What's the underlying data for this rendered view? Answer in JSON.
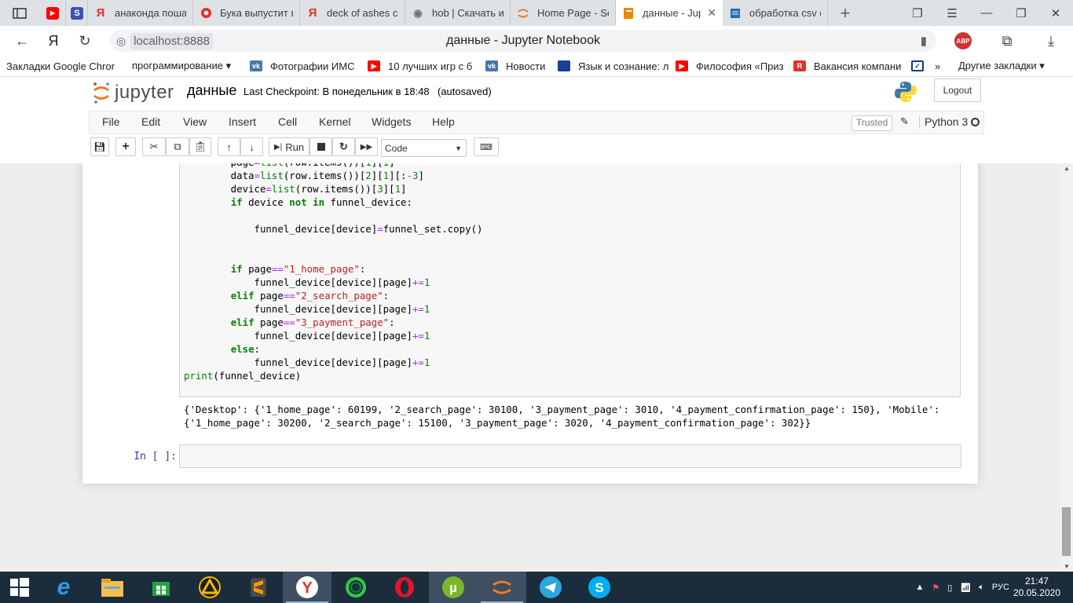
{
  "browser": {
    "tabs": [
      {
        "title": "анаконда поша",
        "favicon": "yandex-icon",
        "color": "#e0322c"
      },
      {
        "title": "Бука выпустит в",
        "favicon": "buka-icon",
        "color": "#e0322c"
      },
      {
        "title": "deck of ashes ск",
        "favicon": "yandex-icon",
        "color": "#e0322c"
      },
      {
        "title": "hob | Скачать иг",
        "favicon": "gamepad-icon",
        "color": "#6b7780"
      },
      {
        "title": "Home Page - Se",
        "favicon": "jupyter-icon",
        "color": "#f37726"
      },
      {
        "title": "данные - Jup",
        "favicon": "notebook-icon",
        "color": "#e68a00"
      },
      {
        "title": "обработка csv ф",
        "favicon": "stack-icon",
        "color": "#1f6fb5"
      }
    ],
    "url": "localhost:8888",
    "page_title": "данные - Jupyter Notebook",
    "bookmarks": [
      {
        "label": "Закладки Google Chror",
        "icon": "none",
        "color": ""
      },
      {
        "label": "программирование ▾",
        "icon": "none",
        "color": ""
      },
      {
        "label": "Фотографии ИМС",
        "icon": "vk-icon",
        "color": "#4a76a8"
      },
      {
        "label": "10 лучших игр с б",
        "icon": "youtube-icon",
        "color": "#ff0000"
      },
      {
        "label": "Новости",
        "icon": "vk-icon",
        "color": "#4a76a8"
      },
      {
        "label": "Язык и сознание: л",
        "icon": "flag-icon",
        "color": "#1c3f95"
      },
      {
        "label": "Философия «Приз",
        "icon": "youtube-icon",
        "color": "#ff0000"
      },
      {
        "label": "Вакансия компани",
        "icon": "r-icon",
        "color": "#e0322c"
      },
      {
        "label": "",
        "icon": "check-icon",
        "color": "#0a3d91"
      }
    ],
    "bookmarks_more": "»",
    "other_bookmarks": "Другие закладки ▾",
    "abp_label": "ABP"
  },
  "jupyter": {
    "logo_text": "jupyter",
    "notebook_name": "данные",
    "checkpoint": "Last Checkpoint: В понедельник в 18:48",
    "autosaved": "(autosaved)",
    "logout_label": "Logout",
    "menu": [
      "File",
      "Edit",
      "View",
      "Insert",
      "Cell",
      "Kernel",
      "Widgets",
      "Help"
    ],
    "trusted_label": "Trusted",
    "kernel_name": "Python 3",
    "run_label": "Run",
    "cell_type": "Code",
    "empty_prompt": "In [ ]:",
    "output_text": "{'Desktop': {'1_home_page': 60199, '2_search_page': 30100, '3_payment_page': 3010, '4_payment_confirmation_page': 150}, 'Mobile': {'1_home_page': 30200, '2_search_page': 15100, '3_payment_page': 3020, '4_payment_confirmation_page': 302}}"
  },
  "taskbar": {
    "apps": [
      "start-icon",
      "ie-icon",
      "explorer-icon",
      "store-icon",
      "winamp-icon",
      "sublime-icon",
      "yandex-browser-icon",
      "green-circle-icon",
      "opera-icon",
      "utorrent-icon",
      "anaconda-icon",
      "telegram-icon",
      "skype-icon"
    ],
    "lang": "РУС",
    "time": "21:47",
    "date": "20.05.2020"
  }
}
